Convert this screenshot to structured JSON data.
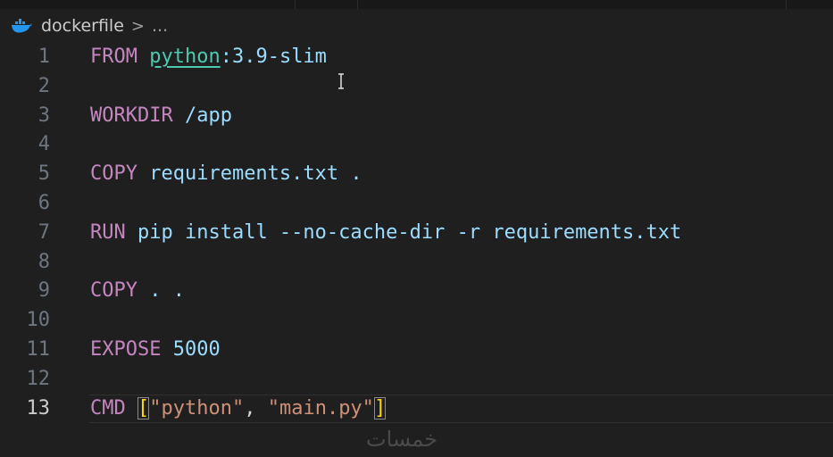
{
  "breadcrumb": {
    "file": "dockerfile",
    "separator": ">",
    "more": "..."
  },
  "editor": {
    "current_line": 13,
    "lines": [
      {
        "number": "1",
        "tokens": [
          {
            "t": "FROM",
            "c": "kw"
          },
          {
            "t": " ",
            "c": "punc"
          },
          {
            "t": "python",
            "c": "img"
          },
          {
            "t": ":3.9-slim",
            "c": "arg"
          }
        ]
      },
      {
        "number": "2",
        "tokens": []
      },
      {
        "number": "3",
        "tokens": [
          {
            "t": "WORKDIR",
            "c": "kw"
          },
          {
            "t": " /app",
            "c": "arg"
          }
        ]
      },
      {
        "number": "4",
        "tokens": []
      },
      {
        "number": "5",
        "tokens": [
          {
            "t": "COPY",
            "c": "kw"
          },
          {
            "t": " requirements.txt .",
            "c": "arg"
          }
        ]
      },
      {
        "number": "6",
        "tokens": []
      },
      {
        "number": "7",
        "tokens": [
          {
            "t": "RUN",
            "c": "kw"
          },
          {
            "t": " pip install --no-cache-dir -r requirements.txt",
            "c": "arg"
          }
        ]
      },
      {
        "number": "8",
        "tokens": []
      },
      {
        "number": "9",
        "tokens": [
          {
            "t": "COPY",
            "c": "kw"
          },
          {
            "t": " . .",
            "c": "arg"
          }
        ]
      },
      {
        "number": "10",
        "tokens": []
      },
      {
        "number": "11",
        "tokens": [
          {
            "t": "EXPOSE",
            "c": "kw"
          },
          {
            "t": " ",
            "c": "punc"
          },
          {
            "t": "5000",
            "c": "arg"
          }
        ]
      },
      {
        "number": "12",
        "tokens": []
      },
      {
        "number": "13",
        "tokens": [
          {
            "t": "CMD",
            "c": "kw"
          },
          {
            "t": " ",
            "c": "punc"
          },
          {
            "t": "[",
            "c": "brk"
          },
          {
            "t": "\"python\"",
            "c": "str"
          },
          {
            "t": ", ",
            "c": "punc"
          },
          {
            "t": "\"main.py\"",
            "c": "str"
          },
          {
            "t": "]",
            "c": "brk"
          }
        ]
      }
    ]
  },
  "icons": {
    "file_icon": "docker-whale-icon",
    "mouse_cursor": "text-cursor-icon"
  },
  "watermark": "خمسات",
  "colors": {
    "background": "#1f1f1f",
    "keyword": "#c586c0",
    "argument": "#9cdcfe",
    "image": "#4ec9b0",
    "string": "#ce9178",
    "bracket": "#ffd700",
    "line_number": "#6e7681",
    "line_number_active": "#cccccc"
  }
}
